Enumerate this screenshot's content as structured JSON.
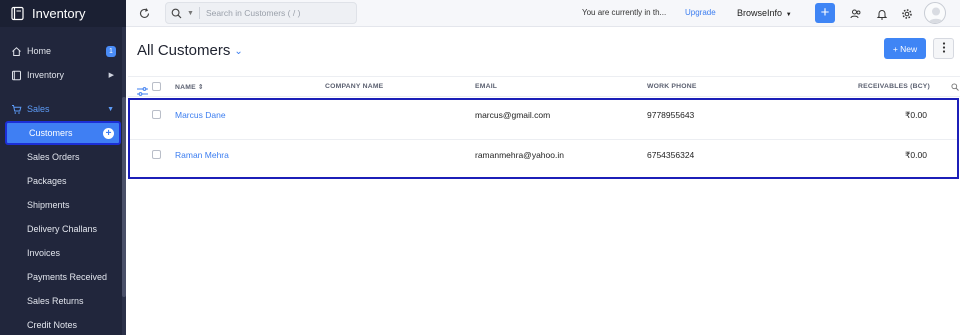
{
  "app": {
    "title": "Inventory"
  },
  "sidebar": {
    "home": {
      "label": "Home",
      "badge": "1"
    },
    "inventory": {
      "label": "Inventory"
    },
    "sales": {
      "label": "Sales"
    },
    "sales_items": [
      {
        "label": "Customers"
      },
      {
        "label": "Sales Orders"
      },
      {
        "label": "Packages"
      },
      {
        "label": "Shipments"
      },
      {
        "label": "Delivery Challans"
      },
      {
        "label": "Invoices"
      },
      {
        "label": "Payments Received"
      },
      {
        "label": "Sales Returns"
      },
      {
        "label": "Credit Notes"
      }
    ]
  },
  "topbar": {
    "search_placeholder": "Search in Customers ( / )",
    "current_text": "You are currently in th...",
    "upgrade_label": "Upgrade",
    "org_name": "BrowseInfo",
    "add_label": "+"
  },
  "page": {
    "title": "All Customers",
    "new_button": "+ New"
  },
  "table": {
    "headers": {
      "name": "NAME",
      "company": "COMPANY NAME",
      "email": "EMAIL",
      "phone": "WORK PHONE",
      "receivables": "RECEIVABLES (BCY)"
    },
    "rows": [
      {
        "name": "Marcus Dane",
        "company": "",
        "email": "marcus@gmail.com",
        "phone": "9778955643",
        "receivables": "₹0.00"
      },
      {
        "name": "Raman Mehra",
        "company": "",
        "email": "ramanmehra@yahoo.in",
        "phone": "6754356324",
        "receivables": "₹0.00"
      }
    ]
  },
  "colors": {
    "sidebar_bg": "#21263c",
    "accent": "#3f85f5",
    "selection_outline": "#1c1fb8"
  }
}
